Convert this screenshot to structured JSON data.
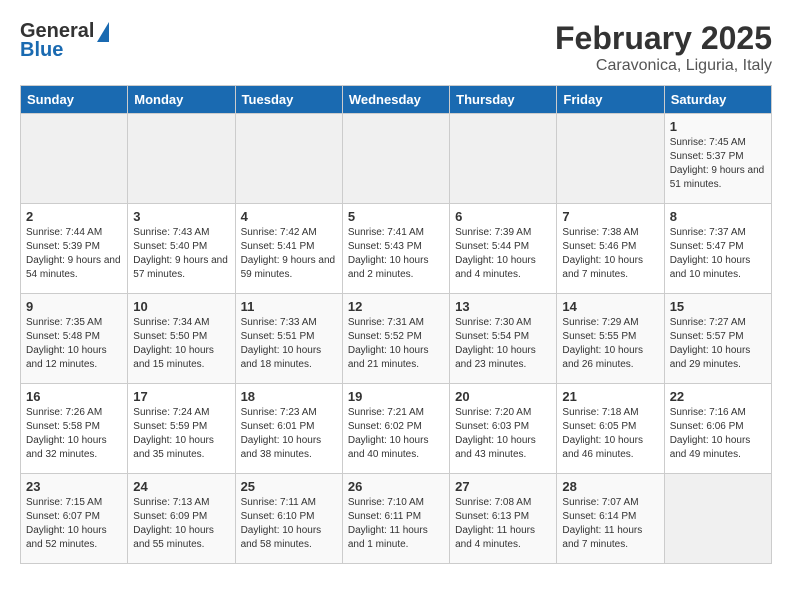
{
  "header": {
    "logo_line1": "General",
    "logo_line2": "Blue",
    "month": "February 2025",
    "location": "Caravonica, Liguria, Italy"
  },
  "weekdays": [
    "Sunday",
    "Monday",
    "Tuesday",
    "Wednesday",
    "Thursday",
    "Friday",
    "Saturday"
  ],
  "weeks": [
    [
      {
        "day": "",
        "info": ""
      },
      {
        "day": "",
        "info": ""
      },
      {
        "day": "",
        "info": ""
      },
      {
        "day": "",
        "info": ""
      },
      {
        "day": "",
        "info": ""
      },
      {
        "day": "",
        "info": ""
      },
      {
        "day": "1",
        "info": "Sunrise: 7:45 AM\nSunset: 5:37 PM\nDaylight: 9 hours and 51 minutes."
      }
    ],
    [
      {
        "day": "2",
        "info": "Sunrise: 7:44 AM\nSunset: 5:39 PM\nDaylight: 9 hours and 54 minutes."
      },
      {
        "day": "3",
        "info": "Sunrise: 7:43 AM\nSunset: 5:40 PM\nDaylight: 9 hours and 57 minutes."
      },
      {
        "day": "4",
        "info": "Sunrise: 7:42 AM\nSunset: 5:41 PM\nDaylight: 9 hours and 59 minutes."
      },
      {
        "day": "5",
        "info": "Sunrise: 7:41 AM\nSunset: 5:43 PM\nDaylight: 10 hours and 2 minutes."
      },
      {
        "day": "6",
        "info": "Sunrise: 7:39 AM\nSunset: 5:44 PM\nDaylight: 10 hours and 4 minutes."
      },
      {
        "day": "7",
        "info": "Sunrise: 7:38 AM\nSunset: 5:46 PM\nDaylight: 10 hours and 7 minutes."
      },
      {
        "day": "8",
        "info": "Sunrise: 7:37 AM\nSunset: 5:47 PM\nDaylight: 10 hours and 10 minutes."
      }
    ],
    [
      {
        "day": "9",
        "info": "Sunrise: 7:35 AM\nSunset: 5:48 PM\nDaylight: 10 hours and 12 minutes."
      },
      {
        "day": "10",
        "info": "Sunrise: 7:34 AM\nSunset: 5:50 PM\nDaylight: 10 hours and 15 minutes."
      },
      {
        "day": "11",
        "info": "Sunrise: 7:33 AM\nSunset: 5:51 PM\nDaylight: 10 hours and 18 minutes."
      },
      {
        "day": "12",
        "info": "Sunrise: 7:31 AM\nSunset: 5:52 PM\nDaylight: 10 hours and 21 minutes."
      },
      {
        "day": "13",
        "info": "Sunrise: 7:30 AM\nSunset: 5:54 PM\nDaylight: 10 hours and 23 minutes."
      },
      {
        "day": "14",
        "info": "Sunrise: 7:29 AM\nSunset: 5:55 PM\nDaylight: 10 hours and 26 minutes."
      },
      {
        "day": "15",
        "info": "Sunrise: 7:27 AM\nSunset: 5:57 PM\nDaylight: 10 hours and 29 minutes."
      }
    ],
    [
      {
        "day": "16",
        "info": "Sunrise: 7:26 AM\nSunset: 5:58 PM\nDaylight: 10 hours and 32 minutes."
      },
      {
        "day": "17",
        "info": "Sunrise: 7:24 AM\nSunset: 5:59 PM\nDaylight: 10 hours and 35 minutes."
      },
      {
        "day": "18",
        "info": "Sunrise: 7:23 AM\nSunset: 6:01 PM\nDaylight: 10 hours and 38 minutes."
      },
      {
        "day": "19",
        "info": "Sunrise: 7:21 AM\nSunset: 6:02 PM\nDaylight: 10 hours and 40 minutes."
      },
      {
        "day": "20",
        "info": "Sunrise: 7:20 AM\nSunset: 6:03 PM\nDaylight: 10 hours and 43 minutes."
      },
      {
        "day": "21",
        "info": "Sunrise: 7:18 AM\nSunset: 6:05 PM\nDaylight: 10 hours and 46 minutes."
      },
      {
        "day": "22",
        "info": "Sunrise: 7:16 AM\nSunset: 6:06 PM\nDaylight: 10 hours and 49 minutes."
      }
    ],
    [
      {
        "day": "23",
        "info": "Sunrise: 7:15 AM\nSunset: 6:07 PM\nDaylight: 10 hours and 52 minutes."
      },
      {
        "day": "24",
        "info": "Sunrise: 7:13 AM\nSunset: 6:09 PM\nDaylight: 10 hours and 55 minutes."
      },
      {
        "day": "25",
        "info": "Sunrise: 7:11 AM\nSunset: 6:10 PM\nDaylight: 10 hours and 58 minutes."
      },
      {
        "day": "26",
        "info": "Sunrise: 7:10 AM\nSunset: 6:11 PM\nDaylight: 11 hours and 1 minute."
      },
      {
        "day": "27",
        "info": "Sunrise: 7:08 AM\nSunset: 6:13 PM\nDaylight: 11 hours and 4 minutes."
      },
      {
        "day": "28",
        "info": "Sunrise: 7:07 AM\nSunset: 6:14 PM\nDaylight: 11 hours and 7 minutes."
      },
      {
        "day": "",
        "info": ""
      }
    ]
  ]
}
